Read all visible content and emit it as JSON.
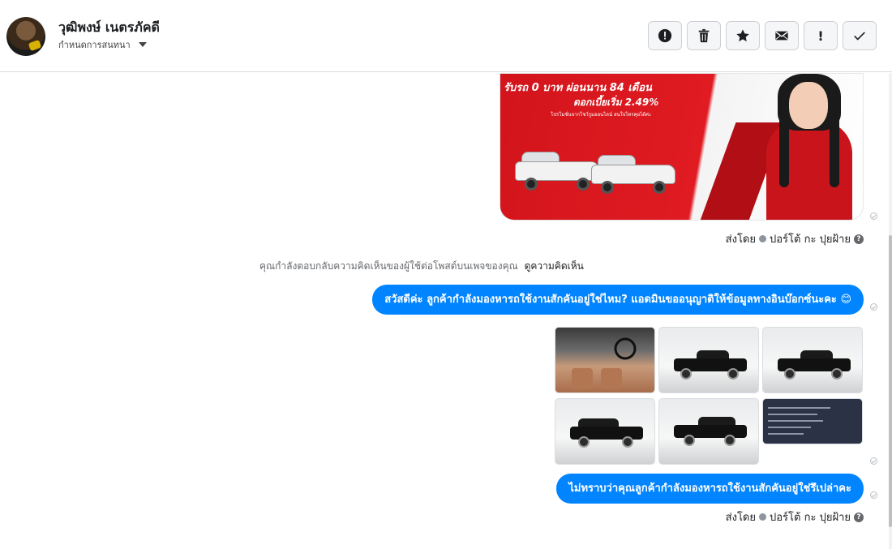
{
  "header": {
    "user_name": "วุฒิพงษ์ เนตรภัคดี",
    "convo_action_label": "กำหนดการสนทนา",
    "toolbar": [
      {
        "name": "mark-spam-button",
        "icon": "alert-circle-icon"
      },
      {
        "name": "delete-button",
        "icon": "trash-icon"
      },
      {
        "name": "star-button",
        "icon": "star-icon"
      },
      {
        "name": "mark-unread-button",
        "icon": "envelope-icon"
      },
      {
        "name": "follow-up-button",
        "icon": "exclamation-icon",
        "label": "!"
      },
      {
        "name": "mark-done-button",
        "icon": "check-icon"
      }
    ]
  },
  "ad": {
    "line1": "รับรถ 0 บาท ผ่อนนาน 84 เดือน",
    "line2": "ดอกเบี้ยเริ่ม 2.49%",
    "line3": "โปรโมชั่นจากโชว์รูมออนไลน์ สนใจโทรคุยได้ค่ะ"
  },
  "sent_by_1": {
    "prefix": "ส่งโดย",
    "name": "ปอร์โต้ กะ ปุยฝ้าย",
    "help": "?"
  },
  "reply_notice": {
    "text": "คุณกำลังตอบกลับความคิดเห็นของผู้ใช้ต่อโพสต์บนเพจของคุณ",
    "link": "ดูความคิดเห็น"
  },
  "messages": {
    "greeting": "สวัสดีค่ะ ลูกค้ากำลังมองหารถใช้งานสักคันอยู่ใช่ไหม? แอดมินขออนุญาติให้ข้อมูลทางอินบ๊อกซ์นะคะ 😊",
    "followup": "ไม่ทราบว่าคุณลูกค้ากำลังมองหารถใช้งานสักคันอยู่ใช่รึเปล่าคะ"
  },
  "sent_by_2": {
    "prefix": "ส่งโดย",
    "name": "ปอร์โต้ กะ ปุยฝ้าย",
    "help": "?"
  }
}
